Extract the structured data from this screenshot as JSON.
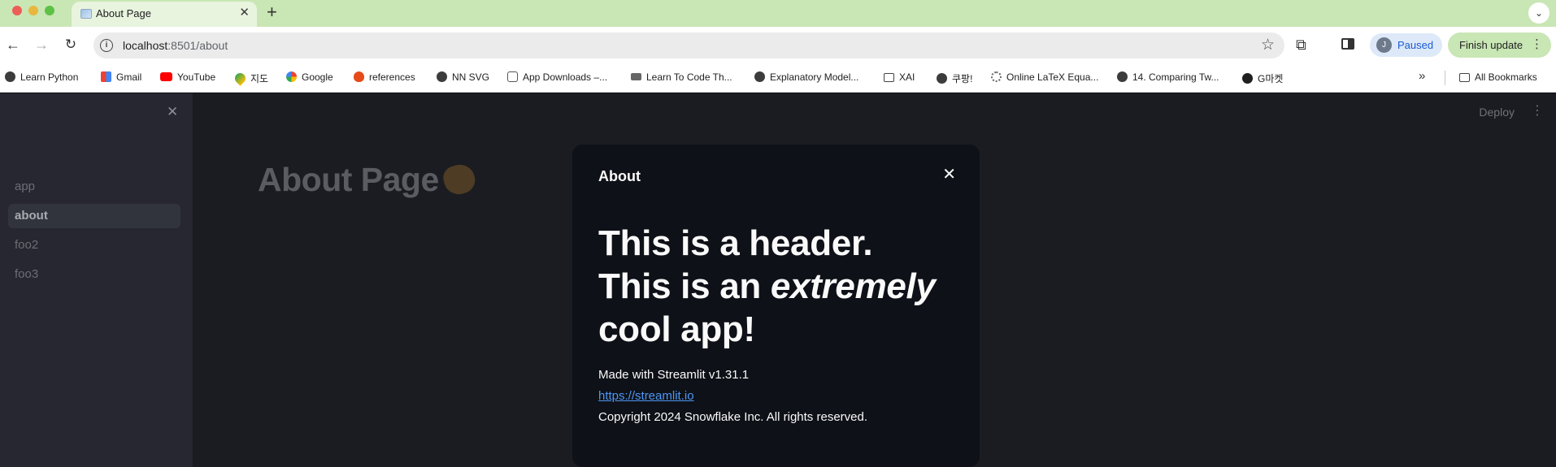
{
  "browser": {
    "tab_title": "About Page",
    "tab_close": "✕",
    "new_tab": "+",
    "tab_menu": "⌄",
    "url_host": "localhost",
    "url_rest": ":8501/about",
    "profile_initial": "J",
    "profile_label": "Paused",
    "update_label": "Finish update",
    "menu_dots": "⋮",
    "back": "←",
    "forward": "→",
    "reload": "↻",
    "star": "☆",
    "extensions": "⧉"
  },
  "bookmarks": [
    {
      "label": "Learn Python",
      "icon": "globe-icon"
    },
    {
      "label": "Gmail",
      "icon": "gmail-icon"
    },
    {
      "label": "YouTube",
      "icon": "youtube-icon"
    },
    {
      "label": "지도",
      "icon": "maps-icon"
    },
    {
      "label": "Google",
      "icon": "google-icon"
    },
    {
      "label": "references",
      "icon": "flame-icon"
    },
    {
      "label": "NN SVG",
      "icon": "globe-icon"
    },
    {
      "label": "App Downloads –...",
      "icon": "app-icon"
    },
    {
      "label": "Learn To Code Th...",
      "icon": "cap-icon"
    },
    {
      "label": "Explanatory Model...",
      "icon": "globe-icon"
    },
    {
      "label": "XAI",
      "icon": "folder-icon"
    },
    {
      "label": "쿠팡!",
      "icon": "globe-icon"
    },
    {
      "label": "Online LaTeX Equa...",
      "icon": "gear-icon"
    },
    {
      "label": "14. Comparing Tw...",
      "icon": "globe-icon"
    },
    {
      "label": "G마켓",
      "icon": "gmarket-icon"
    }
  ],
  "bookmarks_more": "»",
  "all_bookmarks": "All Bookmarks",
  "sidebar": {
    "close": "✕",
    "items": [
      {
        "label": "app"
      },
      {
        "label": "about"
      },
      {
        "label": "foo2"
      },
      {
        "label": "foo3"
      }
    ]
  },
  "main": {
    "deploy": "Deploy",
    "menu": "⋮",
    "page_title": "About Page"
  },
  "dialog": {
    "title": "About",
    "close": "✕",
    "header_part1": "This is a header. This is an ",
    "header_em": "extremely",
    "header_part2": " cool app!",
    "made_with": "Made with Streamlit v1.31.1",
    "link": "https://streamlit.io",
    "copyright": "Copyright 2024 Snowflake Inc. All rights reserved."
  },
  "colors": {
    "tab_strip": "#c9e6b5",
    "sidebar_bg": "#262730",
    "main_bg": "#1a1c22",
    "dialog_bg": "#0e1117",
    "link": "#4e97f5"
  }
}
